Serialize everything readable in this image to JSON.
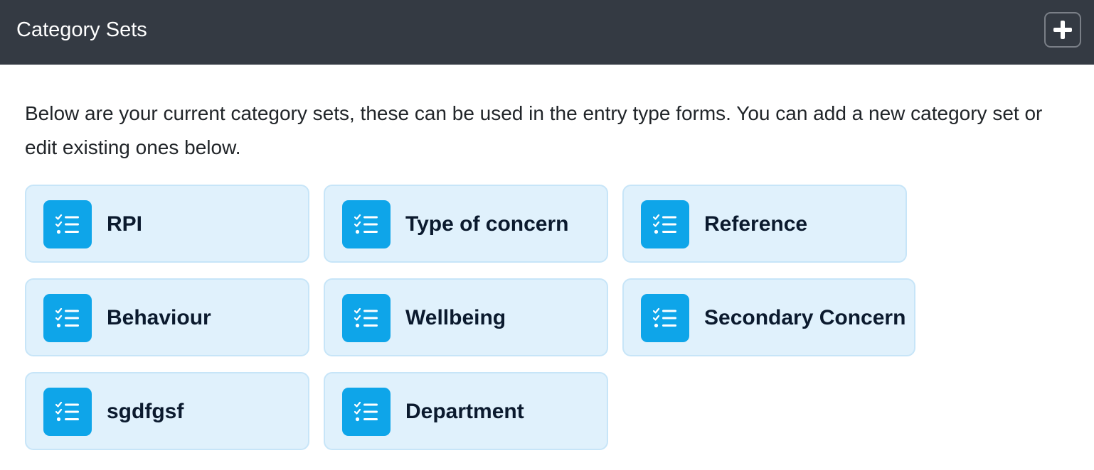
{
  "header": {
    "title": "Category Sets",
    "add_icon": "plus-icon"
  },
  "intro": {
    "text": "Below are your current category sets, these can be used in the entry type forms. You can add a new category set or edit existing ones below."
  },
  "category_sets": [
    {
      "label": "RPI",
      "icon": "checklist-icon"
    },
    {
      "label": "Type of concern",
      "icon": "checklist-icon"
    },
    {
      "label": "Reference",
      "icon": "checklist-icon"
    },
    {
      "label": "Behaviour",
      "icon": "checklist-icon"
    },
    {
      "label": "Wellbeing",
      "icon": "checklist-icon"
    },
    {
      "label": "Secondary Concern",
      "icon": "checklist-icon"
    },
    {
      "label": "sgdfgsf",
      "icon": "checklist-icon"
    },
    {
      "label": "Department",
      "icon": "checklist-icon"
    }
  ],
  "colors": {
    "header_bg": "#343a43",
    "card_bg": "#e0f1fc",
    "card_border": "#c7e5f8",
    "icon_tile": "#0ea5e9",
    "label_text": "#0b1a2e"
  }
}
